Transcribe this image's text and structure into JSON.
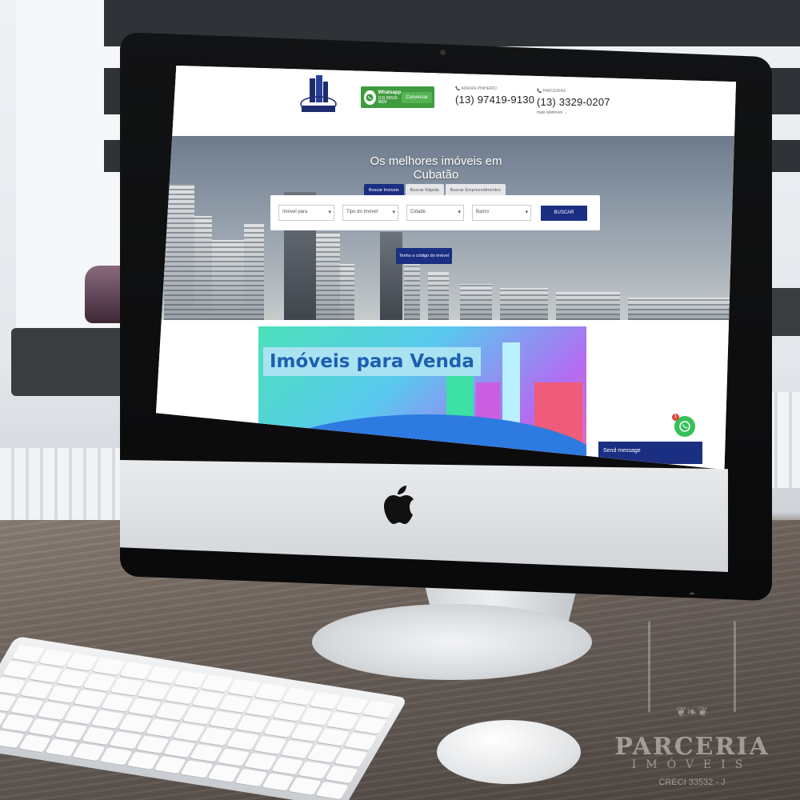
{
  "site": {
    "logo_caption": "PARCERIA",
    "whatsapp": {
      "title": "Whatsapp",
      "number": "(13) 99536-4894",
      "button": "Conversar"
    },
    "contacts": [
      {
        "label": "ADRIAN PINHEIRO",
        "number": "(13) 97419-9130",
        "more": ""
      },
      {
        "label": "PARCERIAS",
        "number": "(13) 3329-0207",
        "more": "mais telefones"
      }
    ]
  },
  "hero": {
    "title": "Os melhores imóveis em Cubatão",
    "tabs": [
      "Buscar Imóveis",
      "Buscar Rápida",
      "Buscar Empreendimentos"
    ],
    "selects": [
      "Imóvel para",
      "Tipo do Imóvel",
      "Cidade",
      "Bairro"
    ],
    "search_button": "BUSCAR",
    "code_button": "Tenho o código do imóvel"
  },
  "banner": {
    "title": "Imóveis para Venda"
  },
  "chat": {
    "send_message": "Send message",
    "badge": "1"
  },
  "watermark": {
    "name": "PARCERIA",
    "subtitle": "IMÓVEIS",
    "creci": "CRECI 33532 - J"
  },
  "colors": {
    "brand_blue": "#1a2e82",
    "whatsapp_green": "#3f9b3e"
  }
}
